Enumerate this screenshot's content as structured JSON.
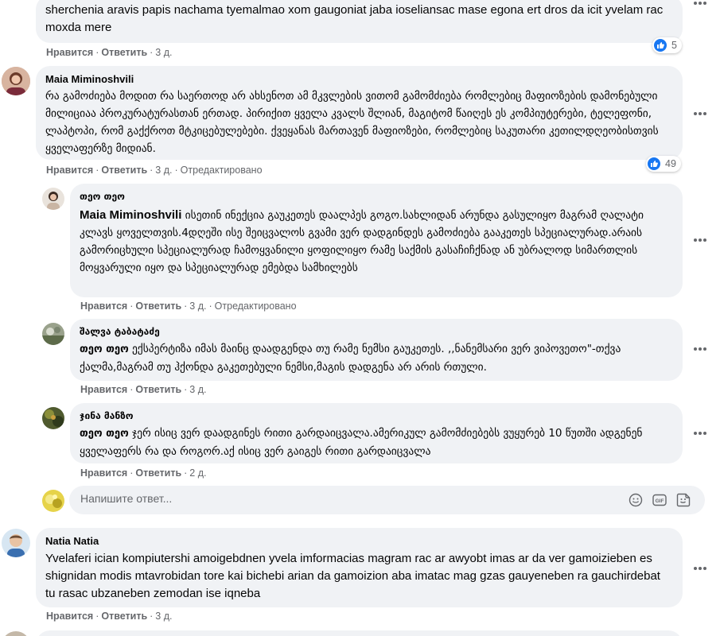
{
  "comment_top": {
    "text": "sherchenia aravis papis nachama tyemalmao xom gaugoniat jaba ioseliansac mase egona ert dros da icit yvelam rac moxda mere",
    "actions": {
      "like": "Нравится",
      "reply": "Ответить",
      "time": "3 д."
    },
    "reactions": "5"
  },
  "comment_maia": {
    "author": "Maia Miminoshvili",
    "text": "რა გამოძიება მოდით რა საერთოდ არ ახსენოთ ამ მკვლების ვითომ გამომძიება რომლებიც მაფიოზების დამონებული მილიციაა პროკურატურასთან ერთად. პირიქით ყველა კვალს შლიან, მაგიტომ წაიღეს ეს კომპიუტერები, ტელეფონი, ლაპტოპი, რომ გაქქროთ მტკიცებულებები. ქვეყანას მართავენ მაფიოზები, რომლებიც საკუთარი კეთილდღეობისთვის ყველაფერზე მიდიან.",
    "actions": {
      "like": "Нравится",
      "reply": "Ответить",
      "time": "3 д.",
      "edited": "Отредактировано"
    },
    "reactions": "49"
  },
  "reply_teo": {
    "author": "თეო თეო",
    "mention": "Maia Miminoshvili",
    "text": "ისეთინ ინექცია გაუკეთეს დაალპეს გოგო.სახლიდან არუნდა გასულიყო მაგრამ ღალატი კლავს ყოველთვის.4დღეში ისე შეიცვალოს გვამი ვერ დადგინდეს გამოძიება გააკეთეს სპეციალურად.არაის გამორიცხული სპეციალურად ჩამოყვანილი ყოფილიყო რამე საქმის გასაჩიჩქნად ან უბრალოდ სიმართლის მოყვარული იყო და სპეციალურად ემებდა სამხილებს",
    "actions": {
      "like": "Нравится",
      "reply": "Ответить",
      "time": "3 д.",
      "edited": "Отредактировано"
    }
  },
  "reply_shalva": {
    "author": "შალვა ტაბატაძე",
    "mention": "თეო თეო",
    "text": "ექსპერტიზა იმას მაინც დაადგენდა თუ რამე ნემსი გაუკეთეს. ,,ნანემსარი ვერ ვიპოვეთო\"-თქვა ქალმა,მაგრამ თუ ჰქონდა გაკეთებული ნემსი,მაგის დადგენა არ არის რთული.",
    "actions": {
      "like": "Нравится",
      "reply": "Ответить",
      "time": "3 д."
    }
  },
  "reply_jina": {
    "author": "ჯინა მანზო",
    "mention": "თეო თეო",
    "text": "ჯერ ისიც ვერ დაადგინეს რითი გარდაიცვალა.ამერიკულ გამომძიებებს ვუყურებ 10 წუთში ადგენენ ყველაფერს რა და როგორ.აქ ისიც ვერ გაიგეს რითი გარდაიცვალა",
    "actions": {
      "like": "Нравится",
      "reply": "Ответить",
      "time": "2 д."
    }
  },
  "reply_input": {
    "placeholder": "Напишите ответ..."
  },
  "comment_natia": {
    "author": "Natia Natia",
    "text": "Yvelaferi ician kompiutershi amoigebdnen yvela imformacias magram rac ar awyobt imas ar da ver gamoizieben es shignidan modis mtavrobidan tore kai bichebi arian da gamoizion aba imatac mag gzas gauyeneben ra gauchirdebat tu rasac ubzaneben zemodan ise iqneba",
    "actions": {
      "like": "Нравится",
      "reply": "Ответить",
      "time": "3 д."
    }
  },
  "icons": [
    "more-icon",
    "like-icon",
    "emoji-icon",
    "gif-icon",
    "sticker-icon"
  ],
  "colors": {
    "bubble": "#f0f2f5",
    "meta": "#65676b",
    "like": "#1877f2",
    "text": "#050505"
  }
}
